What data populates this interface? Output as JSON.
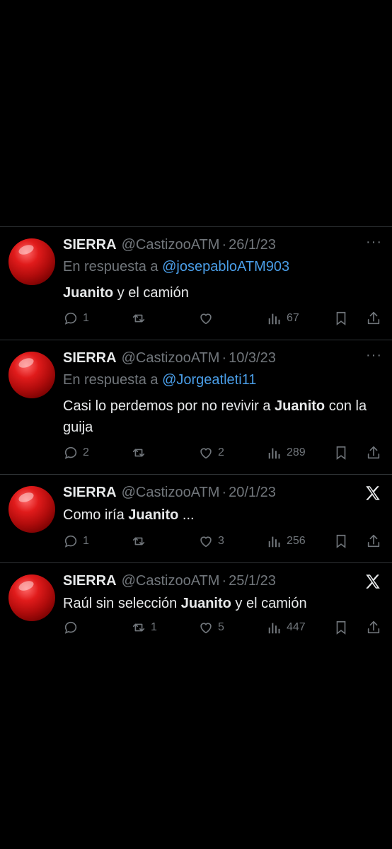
{
  "tweets": [
    {
      "name": "SIERRA",
      "handle": "@CastizooATM",
      "date": "26/1/23",
      "corner_icon": "more-icon",
      "reply_prefix": "En respuesta a",
      "reply_to": "@josepabloATM903",
      "text_parts": [
        {
          "bold": true,
          "text": "Juanito"
        },
        {
          "bold": false,
          "text": " y el camión"
        }
      ],
      "replies": "1",
      "retweets": "",
      "likes": "",
      "views": "67"
    },
    {
      "name": "SIERRA",
      "handle": "@CastizooATM",
      "date": "10/3/23",
      "corner_icon": "more-icon",
      "reply_prefix": "En respuesta a",
      "reply_to": "@Jorgeatleti11",
      "text_parts": [
        {
          "bold": false,
          "text": "Casi lo perdemos por no revivir a "
        },
        {
          "bold": true,
          "text": "Juanito"
        },
        {
          "bold": false,
          "text": " con la guija"
        }
      ],
      "replies": "2",
      "retweets": "",
      "likes": "2",
      "views": "289"
    },
    {
      "name": "SIERRA",
      "handle": "@CastizooATM",
      "date": "20/1/23",
      "corner_icon": "x-logo-icon",
      "text_parts": [
        {
          "bold": false,
          "text": "Como iría "
        },
        {
          "bold": true,
          "text": "Juanito"
        },
        {
          "bold": false,
          "text": " ..."
        }
      ],
      "replies": "1",
      "retweets": "",
      "likes": "3",
      "views": "256"
    },
    {
      "name": "SIERRA",
      "handle": "@CastizooATM",
      "date": "25/1/23",
      "corner_icon": "x-logo-icon",
      "text_parts": [
        {
          "bold": false,
          "text": "Raúl sin selección "
        },
        {
          "bold": true,
          "text": "Juanito"
        },
        {
          "bold": false,
          "text": " y el camión"
        }
      ],
      "replies": "",
      "retweets": "1",
      "likes": "5",
      "views": "447"
    }
  ],
  "colors": {
    "background": "#000000",
    "text": "#e7e9ea",
    "muted": "#71767b",
    "mention": "#4a9ee8",
    "divider": "#2f3336"
  }
}
